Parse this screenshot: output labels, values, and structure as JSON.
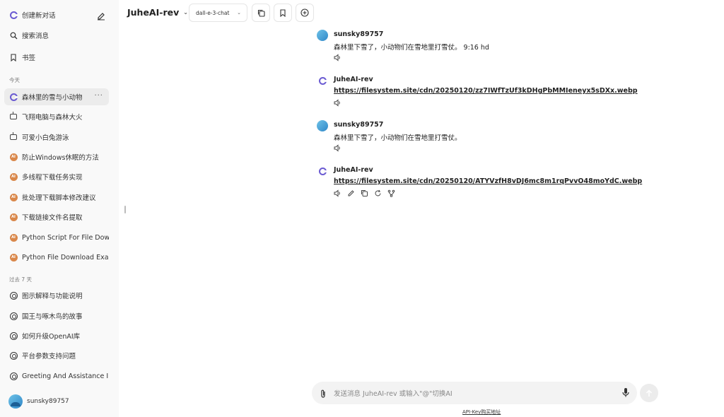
{
  "sidebar": {
    "new_chat": "创建新对话",
    "search": "搜索消息",
    "bookmarks": "书签",
    "section_today": "今天",
    "section_past7": "过去 7 天",
    "today_items": [
      {
        "label": "森林里的雪与小动物",
        "icon": "g-logo-icon"
      },
      {
        "label": "飞翔电脑与森林大火",
        "icon": "robot-icon"
      },
      {
        "label": "可爱小白兔游泳",
        "icon": "robot-icon"
      },
      {
        "label": "防止Windows休眠的方法",
        "icon": "ai-badge-icon"
      },
      {
        "label": "多线程下载任务实现",
        "icon": "ai-badge-icon"
      },
      {
        "label": "批处理下载脚本修改建议",
        "icon": "ai-badge-icon"
      },
      {
        "label": "下载链接文件名提取",
        "icon": "ai-badge-icon"
      },
      {
        "label": "Python Script For File Download",
        "icon": "ai-badge-icon"
      },
      {
        "label": "Python File Download Example",
        "icon": "ai-badge-icon"
      }
    ],
    "past_items": [
      {
        "label": "图示解释与功能说明",
        "icon": "openai-icon"
      },
      {
        "label": "国王与啄木鸟的故事",
        "icon": "openai-icon"
      },
      {
        "label": "如何升级OpenAI库",
        "icon": "openai-icon"
      },
      {
        "label": "平台参数支持问题",
        "icon": "openai-icon"
      },
      {
        "label": "Greeting And Assistance Inquiry",
        "icon": "openai-icon"
      }
    ],
    "username": "sunsky89757",
    "more_label": "···",
    "ai_badge_text": "AI"
  },
  "header": {
    "title": "JuheAI-rev",
    "model": "dall-e-3-chat",
    "chevron": "⌄"
  },
  "messages": [
    {
      "author": "sunsky89757",
      "role": "user",
      "text": "森林里下雪了，小动物们在雪地里打雪仗。 9:16 hd"
    },
    {
      "author": "JuheAI-rev",
      "role": "bot",
      "link": "https://filesystem.site/cdn/20250120/zz7IWfTzUf3kDHgPbMMIeneyx5sDXx.webp"
    },
    {
      "author": "sunsky89757",
      "role": "user",
      "text": "森林里下雪了，小动物们在雪地里打雪仗。"
    },
    {
      "author": "JuheAI-rev",
      "role": "bot",
      "link": "https://filesystem.site/cdn/20250120/ATYVzfH8vDJ6mc8m1rqPvvO48moYdC.webp"
    }
  ],
  "composer": {
    "placeholder": "发送消息 JuheAI-rev 或输入\"@\"切换AI",
    "api_link": "API-Key购买地址"
  },
  "colors": {
    "sidebar_bg": "#f9f9f9",
    "active_item_bg": "#ececec",
    "accent_purple": "#6b5bd2",
    "ai_badge": "#d9874a"
  }
}
